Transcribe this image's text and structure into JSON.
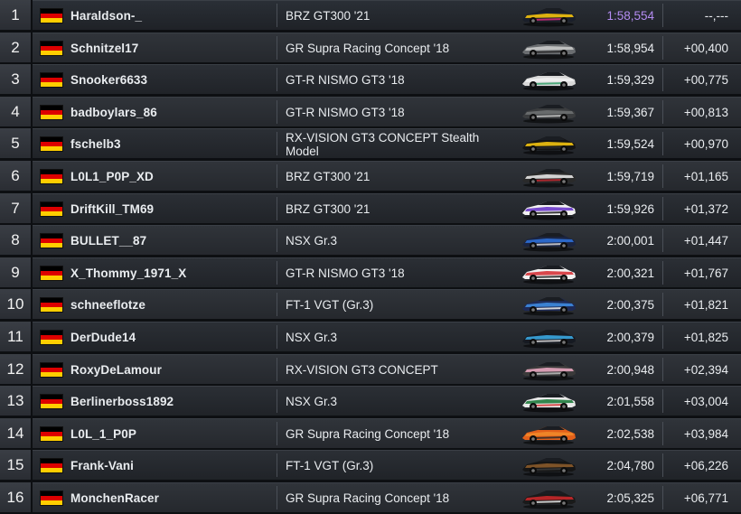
{
  "rows": [
    {
      "pos": "1",
      "name": "Haraldson-_",
      "car": "BRZ GT300 '21",
      "lap": "1:58,554",
      "gap": "--,---",
      "best": true,
      "livery": [
        "#1a1f2a",
        "#f4c20d",
        "#d62a7a"
      ]
    },
    {
      "pos": "2",
      "name": "Schnitzel17",
      "car": "GR Supra Racing Concept '18",
      "lap": "1:58,954",
      "gap": "+00,400",
      "livery": [
        "#6a6d70",
        "#c9c9c9",
        "#2a2a2a"
      ]
    },
    {
      "pos": "3",
      "name": "Snooker6633",
      "car": "GT-R NISMO GT3 '18",
      "lap": "1:59,329",
      "gap": "+00,775",
      "livery": [
        "#d8d8d8",
        "#f1f1f1",
        "#35a16b"
      ]
    },
    {
      "pos": "4",
      "name": "badboylars_86",
      "car": "GT-R NISMO GT3 '18",
      "lap": "1:59,367",
      "gap": "+00,813",
      "livery": [
        "#3b3d3f",
        "#6e7071",
        "#c9c9c9"
      ]
    },
    {
      "pos": "5",
      "name": "fschelb3",
      "car": "RX-VISION GT3 CONCEPT Stealth Model",
      "lap": "1:59,524",
      "gap": "+00,970",
      "livery": [
        "#141414",
        "#f3c310",
        "#2a2a2a"
      ]
    },
    {
      "pos": "6",
      "name": "L0L1_P0P_XD",
      "car": "BRZ GT300 '21",
      "lap": "1:59,719",
      "gap": "+01,165",
      "livery": [
        "#2a2a2a",
        "#e5e5e5",
        "#c2262e"
      ]
    },
    {
      "pos": "7",
      "name": "DriftKill_TM69",
      "car": "BRZ GT300 '21",
      "lap": "1:59,926",
      "gap": "+01,372",
      "livery": [
        "#f2f2f2",
        "#6a39c9",
        "#1b1b1b"
      ]
    },
    {
      "pos": "8",
      "name": "BULLET__87",
      "car": "NSX Gr.3",
      "lap": "2:00,001",
      "gap": "+01,447",
      "livery": [
        "#1b2440",
        "#2d6fd6",
        "#d8d8d8"
      ]
    },
    {
      "pos": "9",
      "name": "X_Thommy_1971_X",
      "car": "GT-R NISMO GT3 '18",
      "lap": "2:00,321",
      "gap": "+01,767",
      "livery": [
        "#f1f1f1",
        "#d6343a",
        "#1f1f1f"
      ]
    },
    {
      "pos": "10",
      "name": "schneeflotze",
      "car": "FT-1 VGT (Gr.3)",
      "lap": "2:00,375",
      "gap": "+01,821",
      "livery": [
        "#1e2a55",
        "#3e8be0",
        "#f1f1f1"
      ]
    },
    {
      "pos": "11",
      "name": "DerDude14",
      "car": "NSX Gr.3",
      "lap": "2:00,379",
      "gap": "+01,825",
      "livery": [
        "#161a22",
        "#3aa7e0",
        "#d8d8d8"
      ]
    },
    {
      "pos": "12",
      "name": "RoxyDeLamour",
      "car": "RX-VISION GT3 CONCEPT",
      "lap": "2:00,948",
      "gap": "+02,394",
      "livery": [
        "#3a3a3a",
        "#e8a7c0",
        "#bfbfbf"
      ]
    },
    {
      "pos": "13",
      "name": "Berlinerboss1892",
      "car": "NSX Gr.3",
      "lap": "2:01,558",
      "gap": "+03,004",
      "livery": [
        "#e9e9e9",
        "#1e7b3c",
        "#d33030"
      ]
    },
    {
      "pos": "14",
      "name": "L0L_1_P0P",
      "car": "GR Supra Racing Concept '18",
      "lap": "2:02,538",
      "gap": "+03,984",
      "livery": [
        "#e2601a",
        "#f08a2a",
        "#2a2a2a"
      ]
    },
    {
      "pos": "15",
      "name": "Frank-Vani",
      "car": "FT-1 VGT (Gr.3)",
      "lap": "2:04,780",
      "gap": "+06,226",
      "livery": [
        "#151515",
        "#8a5a2a",
        "#3a3a3a"
      ]
    },
    {
      "pos": "16",
      "name": "MonchenRacer",
      "car": "GR Supra Racing Concept '18",
      "lap": "2:05,325",
      "gap": "+06,771",
      "livery": [
        "#1a1a1a",
        "#c8282a",
        "#eaeaea"
      ]
    }
  ]
}
